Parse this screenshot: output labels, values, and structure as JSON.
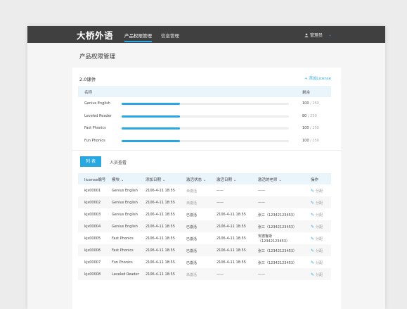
{
  "app": {
    "logo": "大桥外语"
  },
  "nav": {
    "tabs": [
      {
        "label": "产品权限管理",
        "active": true
      },
      {
        "label": "信息管理",
        "active": false
      }
    ],
    "user_label": "管理员"
  },
  "page": {
    "title": "产品权限管理"
  },
  "course": {
    "title": "2.0课件",
    "add_license_label": "添加License",
    "col_name": "名称",
    "col_remaining": "剩余",
    "items": [
      {
        "name": "Genius English",
        "used_fraction": 0.35,
        "remaining": "100",
        "total": "/ 250"
      },
      {
        "name": "Leveled Reader",
        "used_fraction": 0.35,
        "remaining": "80",
        "total": "/ 250"
      },
      {
        "name": "Fast Phonics",
        "used_fraction": 0.35,
        "remaining": "100",
        "total": "/ 250"
      },
      {
        "name": "Fun Phonics",
        "used_fraction": 0.35,
        "remaining": "100",
        "total": "/ 250"
      }
    ]
  },
  "tabs": {
    "list_label": "列 表",
    "people_label": "人员查看"
  },
  "license_table": {
    "headers": {
      "id": "license编号",
      "module": "模块",
      "added": "添加日期",
      "status": "激活状态",
      "activated": "激活日期",
      "teacher": "激活的老师",
      "action": "操作"
    },
    "rows": [
      {
        "id": "kjx00001",
        "module": "Genius English",
        "added": "2106-4-11 18:55",
        "status": "未激活",
        "activated": "——",
        "teacher": "——",
        "action": "分配"
      },
      {
        "id": "kjx00002",
        "module": "Genius English",
        "added": "2106-4-11 18:55",
        "status": "未激活",
        "activated": "——",
        "teacher": "——",
        "action": "分配"
      },
      {
        "id": "kjx00003",
        "module": "Genius English",
        "added": "2106-4-11 18:55",
        "status": "已激活",
        "activated": "2106-4-11 18:55",
        "teacher": "张三（12342123453）",
        "action": "分配"
      },
      {
        "id": "kjx00004",
        "module": "Genius English",
        "added": "2106-4-11 18:55",
        "status": "已激活",
        "activated": "2106-4-11 18:55",
        "teacher": "张三（12342123453）",
        "action": "分配"
      },
      {
        "id": "kjx00005",
        "module": "Fast Phonics",
        "added": "2106-4-11 18:55",
        "status": "已激活",
        "activated": "2106-4-11 18:55",
        "teacher": "安德鲁斯",
        "teacher_line2": "（12342123453）",
        "action": "分配"
      },
      {
        "id": "kjx00006",
        "module": "Fast Phonics",
        "added": "2106-4-11 18:55",
        "status": "已激活",
        "activated": "2106-4-11 18:55",
        "teacher": "张三（12342123453）",
        "action": "分配"
      },
      {
        "id": "kjx00007",
        "module": "Fun Phonics",
        "added": "2106-4-11 18:55",
        "status": "已激活",
        "activated": "2106-4-11 18:55",
        "teacher": "张三（12342123453）",
        "action": "分配"
      },
      {
        "id": "kjx00008",
        "module": "Leveled Reader",
        "added": "2106-4-11 18:55",
        "status": "未激活",
        "activated": "——",
        "teacher": "——",
        "action": "分配"
      }
    ]
  },
  "colors": {
    "accent": "#29a7e1",
    "topbar": "#404040",
    "header_bg": "#eaf4fb"
  }
}
